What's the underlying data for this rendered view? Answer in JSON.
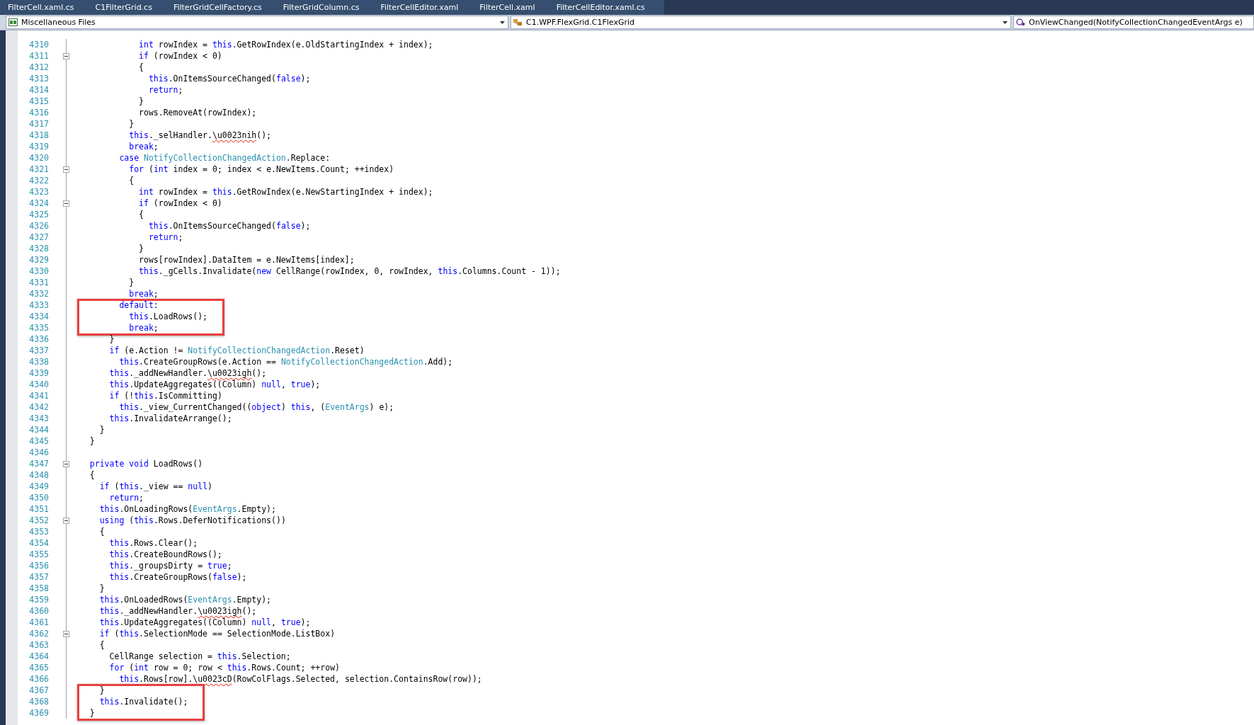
{
  "tabs": [
    {
      "label": "FilterCell.xaml.cs"
    },
    {
      "label": "C1FilterGrid.cs"
    },
    {
      "label": "FilterGridCellFactory.cs"
    },
    {
      "label": "FilterGridColumn.cs"
    },
    {
      "label": "FilterCellEditor.xaml"
    },
    {
      "label": "FilterCell.xaml"
    },
    {
      "label": "FilterCellEditor.xaml.cs"
    }
  ],
  "navigation": {
    "project": "Miscellaneous Files",
    "type": "C1.WPF.FlexGrid.C1FlexGrid",
    "member": "OnViewChanged(NotifyCollectionChangedEventArgs e)"
  },
  "lines": [
    {
      "children": [
        {
          "children": [
            {
              "children": [
                {
                  "children": [
                    {
                      "children": [
                        {
                          "children": [
                            {
                              "number": "4310",
                              "fold": false,
                              "boxed": false,
                              "tokens": [
                                {
                                  "kind": "kw",
                                  "text": "int"
                                },
                                {
                                  "kind": "plain",
                                  "text": " rowIndex = "
                                },
                                {
                                  "kind": "kw",
                                  "text": "this"
                                },
                                {
                                  "kind": "plain",
                                  "text": ".GetRowIndex(e.OldStartingIndex + index);"
                                }
                              ]
                            },
                            {
                              "number": "4311",
                              "fold": true,
                              "boxed": false,
                              "tokens": [
                                {
                                  "kind": "kw",
                                  "text": "if"
                                },
                                {
                                  "kind": "plain",
                                  "text": " (rowIndex < 0)"
                                }
                              ]
                            },
                            {
                              "number": "4312",
                              "fold": false,
                              "boxed": false,
                              "tokens": [
                                {
                                  "kind": "plain",
                                  "text": "{"
                                }
                              ]
                            },
                            {
                              "children": [
                                {
                                  "number": "4313",
                                  "fold": false,
                                  "boxed": false,
                                  "tokens": [
                                    {
                                      "kind": "kw",
                                      "text": "this"
                                    },
                                    {
                                      "kind": "plain",
                                      "text": ".OnItemsSourceChanged("
                                    },
                                    {
                                      "kind": "kw",
                                      "text": "false"
                                    },
                                    {
                                      "kind": "plain",
                                      "text": ");"
                                    }
                                  ]
                                },
                                {
                                  "number": "4314",
                                  "fold": false,
                                  "boxed": false,
                                  "tokens": [
                                    {
                                      "kind": "kw",
                                      "text": "return"
                                    },
                                    {
                                      "kind": "plain",
                                      "text": ";"
                                    }
                                  ]
                                }
                              ]
                            },
                            {
                              "number": "4315",
                              "fold": false,
                              "boxed": false,
                              "tokens": [
                                {
                                  "kind": "plain",
                                  "text": "}"
                                }
                              ]
                            },
                            {
                              "number": "4316",
                              "fold": false,
                              "boxed": false,
                              "tokens": [
                                {
                                  "kind": "plain",
                                  "text": "rows.RemoveAt(rowIndex);"
                                }
                              ]
                            }
                          ]
                        },
                        {
                          "number": "4317",
                          "fold": false,
                          "boxed": false,
                          "tokens": [
                            {
                              "kind": "plain",
                              "text": "}"
                            }
                          ]
                        },
                        {
                          "number": "4318",
                          "fold": false,
                          "boxed": false,
                          "tokens": [
                            {
                              "kind": "kw",
                              "text": "this"
                            },
                            {
                              "kind": "plain",
                              "text": "._selHandler."
                            },
                            {
                              "kind": "err",
                              "text": "\\u0023nih"
                            },
                            {
                              "kind": "plain",
                              "text": "();"
                            }
                          ]
                        },
                        {
                          "number": "4319",
                          "fold": false,
                          "boxed": false,
                          "tokens": [
                            {
                              "kind": "kw",
                              "text": "break"
                            },
                            {
                              "kind": "plain",
                              "text": ";"
                            }
                          ]
                        }
                      ]
                    },
                    {
                      "number": "4320",
                      "fold": false,
                      "boxed": false,
                      "tokens": [
                        {
                          "kind": "kw",
                          "text": "case"
                        },
                        {
                          "kind": "type",
                          "text": " NotifyCollectionChangedAction"
                        },
                        {
                          "kind": "plain",
                          "text": ".Replace:"
                        }
                      ]
                    },
                    {
                      "children": [
                        {
                          "number": "4321",
                          "fold": true,
                          "boxed": false,
                          "tokens": [
                            {
                              "kind": "kw",
                              "text": "for"
                            },
                            {
                              "kind": "plain",
                              "text": " ("
                            },
                            {
                              "kind": "kw",
                              "text": "int"
                            },
                            {
                              "kind": "plain",
                              "text": " index = 0; index < e.NewItems.Count; ++index)"
                            }
                          ]
                        },
                        {
                          "number": "4322",
                          "fold": false,
                          "boxed": false,
                          "tokens": [
                            {
                              "kind": "plain",
                              "text": "{"
                            }
                          ]
                        },
                        {
                          "children": [
                            {
                              "number": "4323",
                              "fold": false,
                              "boxed": false,
                              "tokens": [
                                {
                                  "kind": "kw",
                                  "text": "int"
                                },
                                {
                                  "kind": "plain",
                                  "text": " rowIndex = "
                                },
                                {
                                  "kind": "kw",
                                  "text": "this"
                                },
                                {
                                  "kind": "plain",
                                  "text": ".GetRowIndex(e.NewStartingIndex + index);"
                                }
                              ]
                            },
                            {
                              "number": "4324",
                              "fold": true,
                              "boxed": false,
                              "tokens": [
                                {
                                  "kind": "kw",
                                  "text": "if"
                                },
                                {
                                  "kind": "plain",
                                  "text": " (rowIndex < 0)"
                                }
                              ]
                            },
                            {
                              "number": "4325",
                              "fold": false,
                              "boxed": false,
                              "tokens": [
                                {
                                  "kind": "plain",
                                  "text": "{"
                                }
                              ]
                            },
                            {
                              "children": [
                                {
                                  "number": "4326",
                                  "fold": false,
                                  "boxed": false,
                                  "tokens": [
                                    {
                                      "kind": "kw",
                                      "text": "this"
                                    },
                                    {
                                      "kind": "plain",
                                      "text": ".OnItemsSourceChanged("
                                    },
                                    {
                                      "kind": "kw",
                                      "text": "false"
                                    },
                                    {
                                      "kind": "plain",
                                      "text": ");"
                                    }
                                  ]
                                },
                                {
                                  "number": "4327",
                                  "fold": false,
                                  "boxed": false,
                                  "tokens": [
                                    {
                                      "kind": "kw",
                                      "text": "return"
                                    },
                                    {
                                      "kind": "plain",
                                      "text": ";"
                                    }
                                  ]
                                }
                              ]
                            },
                            {
                              "number": "4328",
                              "fold": false,
                              "boxed": false,
                              "tokens": [
                                {
                                  "kind": "plain",
                                  "text": "}"
                                }
                              ]
                            },
                            {
                              "number": "4329",
                              "fold": false,
                              "boxed": false,
                              "tokens": [
                                {
                                  "kind": "plain",
                                  "text": "rows[rowIndex].DataItem = e.NewItems[index];"
                                }
                              ]
                            },
                            {
                              "number": "4330",
                              "fold": false,
                              "boxed": false,
                              "tokens": [
                                {
                                  "kind": "kw",
                                  "text": "this"
                                },
                                {
                                  "kind": "plain",
                                  "text": "._gCells.Invalidate("
                                },
                                {
                                  "kind": "kw",
                                  "text": "new"
                                },
                                {
                                  "kind": "plain",
                                  "text": " CellRange(rowIndex, 0, rowIndex, "
                                },
                                {
                                  "kind": "kw",
                                  "text": "this"
                                },
                                {
                                  "kind": "plain",
                                  "text": ".Columns.Count - 1));"
                                }
                              ]
                            }
                          ]
                        },
                        {
                          "number": "4331",
                          "fold": false,
                          "boxed": false,
                          "tokens": [
                            {
                              "kind": "plain",
                              "text": "}"
                            }
                          ]
                        },
                        {
                          "number": "4332",
                          "fold": false,
                          "boxed": false,
                          "tokens": [
                            {
                              "kind": "kw",
                              "text": "break"
                            },
                            {
                              "kind": "plain",
                              "text": ";"
                            }
                          ]
                        }
                      ]
                    },
                    {
                      "number": "4333",
                      "fold": false,
                      "boxed": true,
                      "tokens": [
                        {
                          "kind": "kw",
                          "text": "default"
                        },
                        {
                          "kind": "plain",
                          "text": ":"
                        }
                      ]
                    },
                    {
                      "children": [
                        {
                          "number": "4334",
                          "fold": false,
                          "boxed": true,
                          "tokens": [
                            {
                              "kind": "kw",
                              "text": "this"
                            },
                            {
                              "kind": "plain",
                              "text": ".LoadRows();"
                            }
                          ]
                        },
                        {
                          "number": "4335",
                          "fold": false,
                          "boxed": true,
                          "tokens": [
                            {
                              "kind": "kw",
                              "text": "break"
                            },
                            {
                              "kind": "plain",
                              "text": ";"
                            }
                          ]
                        }
                      ]
                    }
                  ]
                },
                {
                  "number": "4336",
                  "fold": false,
                  "boxed": false,
                  "tokens": [
                    {
                      "kind": "plain",
                      "text": "}"
                    }
                  ]
                },
                {
                  "number": "4337",
                  "fold": false,
                  "boxed": false,
                  "tokens": [
                    {
                      "kind": "kw",
                      "text": "if"
                    },
                    {
                      "kind": "plain",
                      "text": " (e.Action != "
                    },
                    {
                      "kind": "type",
                      "text": "NotifyCollectionChangedAction"
                    },
                    {
                      "kind": "plain",
                      "text": ".Reset)"
                    }
                  ]
                },
                {
                  "children": [
                    {
                      "number": "4338",
                      "fold": false,
                      "boxed": false,
                      "tokens": [
                        {
                          "kind": "kw",
                          "text": "this"
                        },
                        {
                          "kind": "plain",
                          "text": ".CreateGroupRows(e.Action == "
                        },
                        {
                          "kind": "type",
                          "text": "NotifyCollectionChangedAction"
                        },
                        {
                          "kind": "plain",
                          "text": ".Add);"
                        }
                      ]
                    }
                  ]
                },
                {
                  "number": "4339",
                  "fold": false,
                  "boxed": false,
                  "tokens": [
                    {
                      "kind": "kw",
                      "text": "this"
                    },
                    {
                      "kind": "plain",
                      "text": "._addNewHandler."
                    },
                    {
                      "kind": "err",
                      "text": "\\u0023igh"
                    },
                    {
                      "kind": "plain",
                      "text": "();"
                    }
                  ]
                },
                {
                  "number": "4340",
                  "fold": false,
                  "boxed": false,
                  "tokens": [
                    {
                      "kind": "kw",
                      "text": "this"
                    },
                    {
                      "kind": "plain",
                      "text": ".UpdateAggregates((Column) "
                    },
                    {
                      "kind": "kw",
                      "text": "null"
                    },
                    {
                      "kind": "plain",
                      "text": ", "
                    },
                    {
                      "kind": "kw",
                      "text": "true"
                    },
                    {
                      "kind": "plain",
                      "text": ");"
                    }
                  ]
                },
                {
                  "number": "4341",
                  "fold": false,
                  "boxed": false,
                  "tokens": [
                    {
                      "kind": "kw",
                      "text": "if"
                    },
                    {
                      "kind": "plain",
                      "text": " (!"
                    },
                    {
                      "kind": "kw",
                      "text": "this"
                    },
                    {
                      "kind": "plain",
                      "text": ".IsCommitting)"
                    }
                  ]
                },
                {
                  "children": [
                    {
                      "number": "4342",
                      "fold": false,
                      "boxed": false,
                      "tokens": [
                        {
                          "kind": "kw",
                          "text": "this"
                        },
                        {
                          "kind": "plain",
                          "text": "._view_CurrentChanged(("
                        },
                        {
                          "kind": "kw",
                          "text": "object"
                        },
                        {
                          "kind": "plain",
                          "text": ") "
                        },
                        {
                          "kind": "kw",
                          "text": "this"
                        },
                        {
                          "kind": "plain",
                          "text": ", ("
                        },
                        {
                          "kind": "type",
                          "text": "EventArgs"
                        },
                        {
                          "kind": "plain",
                          "text": ") e);"
                        }
                      ]
                    }
                  ]
                },
                {
                  "number": "4343",
                  "fold": false,
                  "boxed": false,
                  "tokens": [
                    {
                      "kind": "kw",
                      "text": "this"
                    },
                    {
                      "kind": "plain",
                      "text": ".InvalidateArrange();"
                    }
                  ]
                }
              ]
            },
            {
              "number": "4344",
              "fold": false,
              "boxed": false,
              "tokens": [
                {
                  "kind": "plain",
                  "text": "}"
                }
              ]
            }
          ]
        },
        {
          "number": "4345",
          "fold": false,
          "boxed": false,
          "tokens": [
            {
              "kind": "plain",
              "text": "}"
            }
          ]
        },
        {
          "number": "4346",
          "fold": false,
          "boxed": false
        },
        {
          "number": "4347",
          "fold": true,
          "boxed": false,
          "tokens": [
            {
              "kind": "kw",
              "text": "private void"
            },
            {
              "kind": "plain",
              "text": " LoadRows()"
            }
          ]
        },
        {
          "number": "4348",
          "fold": false,
          "boxed": false,
          "tokens": [
            {
              "kind": "plain",
              "text": "{"
            }
          ]
        },
        {
          "children": [
            {
              "number": "4349",
              "fold": false,
              "boxed": false,
              "tokens": [
                {
                  "kind": "kw",
                  "text": "if"
                },
                {
                  "kind": "plain",
                  "text": " ("
                },
                {
                  "kind": "kw",
                  "text": "this"
                },
                {
                  "kind": "plain",
                  "text": "._view == "
                },
                {
                  "kind": "kw",
                  "text": "null"
                },
                {
                  "kind": "plain",
                  "text": ")"
                }
              ]
            },
            {
              "children": [
                {
                  "number": "4350",
                  "fold": false,
                  "boxed": false,
                  "tokens": [
                    {
                      "kind": "kw",
                      "text": "return"
                    },
                    {
                      "kind": "plain",
                      "text": ";"
                    }
                  ]
                }
              ]
            },
            {
              "number": "4351",
              "fold": false,
              "boxed": false,
              "tokens": [
                {
                  "kind": "kw",
                  "text": "this"
                },
                {
                  "kind": "plain",
                  "text": ".OnLoadingRows("
                },
                {
                  "kind": "type",
                  "text": "EventArgs"
                },
                {
                  "kind": "plain",
                  "text": ".Empty);"
                }
              ]
            },
            {
              "number": "4352",
              "fold": true,
              "boxed": false,
              "tokens": [
                {
                  "kind": "kw",
                  "text": "using"
                },
                {
                  "kind": "plain",
                  "text": " ("
                },
                {
                  "kind": "kw",
                  "text": "this"
                },
                {
                  "kind": "plain",
                  "text": ".Rows.DeferNotifications())"
                }
              ]
            },
            {
              "number": "4353",
              "fold": false,
              "boxed": false,
              "tokens": [
                {
                  "kind": "plain",
                  "text": "{"
                }
              ]
            },
            {
              "children": [
                {
                  "number": "4354",
                  "fold": false,
                  "boxed": false,
                  "tokens": [
                    {
                      "kind": "kw",
                      "text": "this"
                    },
                    {
                      "kind": "plain",
                      "text": ".Rows.Clear();"
                    }
                  ]
                },
                {
                  "number": "4355",
                  "fold": false,
                  "boxed": false,
                  "tokens": [
                    {
                      "kind": "kw",
                      "text": "this"
                    },
                    {
                      "kind": "plain",
                      "text": ".CreateBoundRows();"
                    }
                  ]
                },
                {
                  "number": "4356",
                  "fold": false,
                  "boxed": false,
                  "tokens": [
                    {
                      "kind": "kw",
                      "text": "this"
                    },
                    {
                      "kind": "plain",
                      "text": "._groupsDirty = "
                    },
                    {
                      "kind": "kw",
                      "text": "true"
                    },
                    {
                      "kind": "plain",
                      "text": ";"
                    }
                  ]
                },
                {
                  "number": "4357",
                  "fold": false,
                  "boxed": false,
                  "tokens": [
                    {
                      "kind": "kw",
                      "text": "this"
                    },
                    {
                      "kind": "plain",
                      "text": ".CreateGroupRows("
                    },
                    {
                      "kind": "kw",
                      "text": "false"
                    },
                    {
                      "kind": "plain",
                      "text": ");"
                    }
                  ]
                }
              ]
            },
            {
              "number": "4358",
              "fold": false,
              "boxed": false,
              "tokens": [
                {
                  "kind": "plain",
                  "text": "}"
                }
              ]
            },
            {
              "number": "4359",
              "fold": false,
              "boxed": false,
              "tokens": [
                {
                  "kind": "kw",
                  "text": "this"
                },
                {
                  "kind": "plain",
                  "text": ".OnLoadedRows("
                },
                {
                  "kind": "type",
                  "text": "EventArgs"
                },
                {
                  "kind": "plain",
                  "text": ".Empty);"
                }
              ]
            },
            {
              "number": "4360",
              "fold": false,
              "boxed": false,
              "tokens": [
                {
                  "kind": "kw",
                  "text": "this"
                },
                {
                  "kind": "plain",
                  "text": "._addNewHandler."
                },
                {
                  "kind": "err",
                  "text": "\\u0023igh"
                },
                {
                  "kind": "plain",
                  "text": "();"
                }
              ]
            },
            {
              "number": "4361",
              "fold": false,
              "boxed": false,
              "tokens": [
                {
                  "kind": "kw",
                  "text": "this"
                },
                {
                  "kind": "plain",
                  "text": ".UpdateAggregates((Column) "
                },
                {
                  "kind": "kw",
                  "text": "null"
                },
                {
                  "kind": "plain",
                  "text": ", "
                },
                {
                  "kind": "kw",
                  "text": "true"
                },
                {
                  "kind": "plain",
                  "text": ");"
                }
              ]
            },
            {
              "number": "4362",
              "fold": true,
              "boxed": false,
              "tokens": [
                {
                  "kind": "kw",
                  "text": "if"
                },
                {
                  "kind": "plain",
                  "text": " ("
                },
                {
                  "kind": "kw",
                  "text": "this"
                },
                {
                  "kind": "plain",
                  "text": ".SelectionMode == SelectionMode.ListBox)"
                }
              ]
            },
            {
              "number": "4363",
              "fold": false,
              "boxed": false,
              "tokens": [
                {
                  "kind": "plain",
                  "text": "{"
                }
              ]
            },
            {
              "children": [
                {
                  "number": "4364",
                  "fold": false,
                  "boxed": false,
                  "tokens": [
                    {
                      "kind": "plain",
                      "text": "CellRange selection = "
                    },
                    {
                      "kind": "kw",
                      "text": "this"
                    },
                    {
                      "kind": "plain",
                      "text": ".Selection;"
                    }
                  ]
                },
                {
                  "number": "4365",
                  "fold": false,
                  "boxed": false,
                  "tokens": [
                    {
                      "kind": "kw",
                      "text": "for"
                    },
                    {
                      "kind": "plain",
                      "text": " ("
                    },
                    {
                      "kind": "kw",
                      "text": "int"
                    },
                    {
                      "kind": "plain",
                      "text": " row = 0; row < "
                    },
                    {
                      "kind": "kw",
                      "text": "this"
                    },
                    {
                      "kind": "plain",
                      "text": ".Rows.Count; ++row)"
                    }
                  ]
                },
                {
                  "children": [
                    {
                      "number": "4366",
                      "fold": false,
                      "boxed": false,
                      "tokens": [
                        {
                          "kind": "kw",
                          "text": "this"
                        },
                        {
                          "kind": "plain",
                          "text": ".Rows[row]."
                        },
                        {
                          "kind": "err",
                          "text": "\\u0023cD"
                        },
                        {
                          "kind": "plain",
                          "text": "(RowColFlags.Selected, selection.ContainsRow(row));"
                        }
                      ]
                    }
                  ]
                }
              ]
            },
            {
              "number": "4367",
              "fold": false,
              "boxed": true,
              "tokens": [
                {
                  "kind": "plain",
                  "text": "}"
                }
              ]
            },
            {
              "number": "4368",
              "fold": false,
              "boxed": true,
              "tokens": [
                {
                  "kind": "kw",
                  "text": "this"
                },
                {
                  "kind": "plain",
                  "text": ".Invalidate();"
                }
              ]
            }
          ]
        },
        {
          "number": "4369",
          "fold": false,
          "boxed": true,
          "tokens": [
            {
              "kind": "plain",
              "text": "}"
            }
          ]
        }
      ]
    }
  ]
}
